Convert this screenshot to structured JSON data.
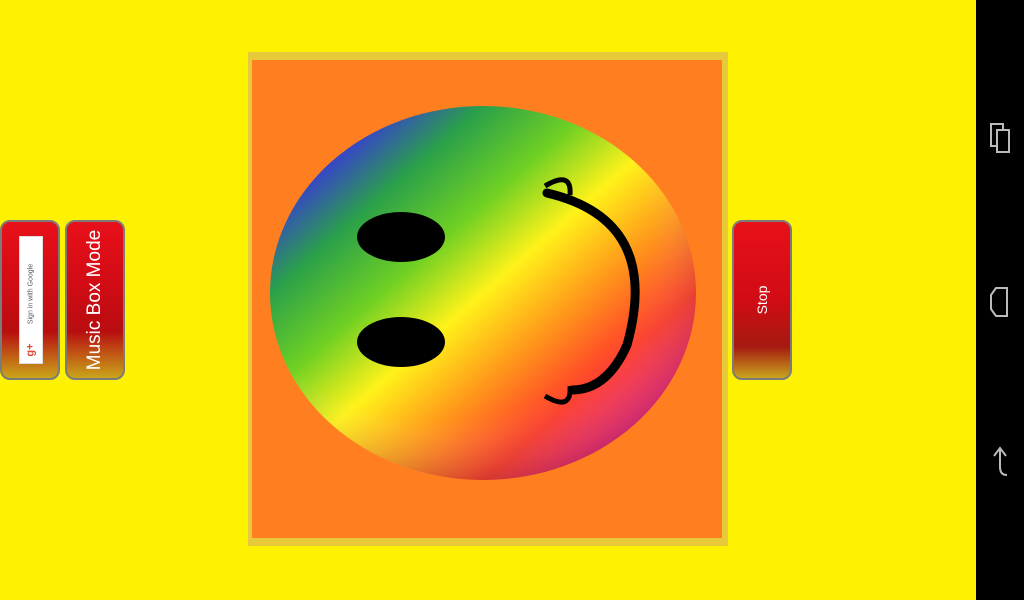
{
  "left_buttons": {
    "google_signin": {
      "label": "Sign in with Google",
      "badge": "g+"
    },
    "music_box": {
      "label": "Music Box Mode"
    }
  },
  "right_buttons": {
    "stop": {
      "label": "Stop"
    }
  },
  "picture": {
    "subject": "rainbow-smiley-face"
  },
  "system_nav": {
    "buttons": [
      "recent-apps",
      "home",
      "back"
    ]
  },
  "colors": {
    "background": "#fff200",
    "picture_background": "#ff7f20",
    "button_red": "#e8101a",
    "navbar": "#000000"
  }
}
